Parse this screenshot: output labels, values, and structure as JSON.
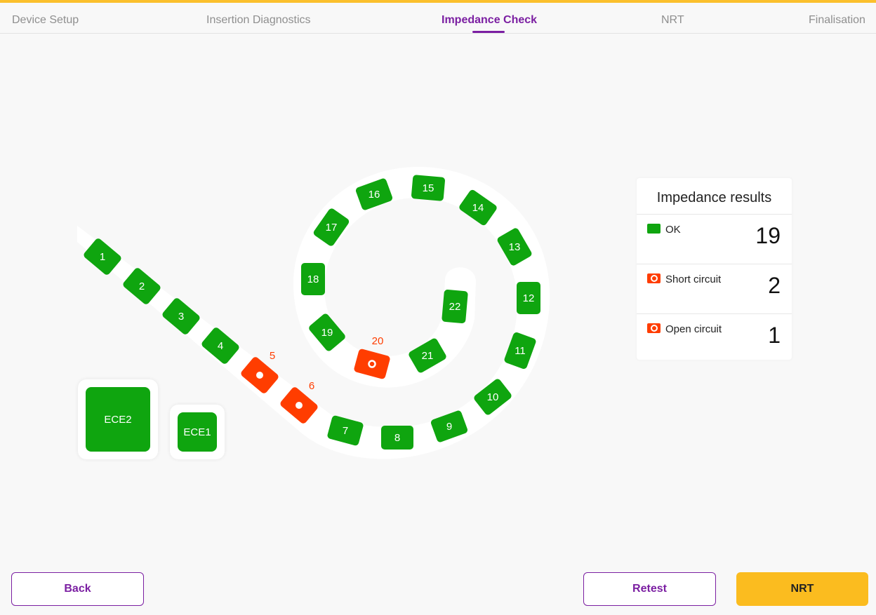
{
  "tabs": [
    {
      "label": "Device Setup",
      "active": false
    },
    {
      "label": "Insertion Diagnostics",
      "active": false
    },
    {
      "label": "Impedance Check",
      "active": true
    },
    {
      "label": "NRT",
      "active": false
    },
    {
      "label": "Finalisation",
      "active": false
    }
  ],
  "electrodes": [
    {
      "label": "1",
      "status": "ok"
    },
    {
      "label": "2",
      "status": "ok"
    },
    {
      "label": "3",
      "status": "ok"
    },
    {
      "label": "4",
      "status": "ok"
    },
    {
      "label": "5",
      "status": "short"
    },
    {
      "label": "6",
      "status": "short"
    },
    {
      "label": "7",
      "status": "ok"
    },
    {
      "label": "8",
      "status": "ok"
    },
    {
      "label": "9",
      "status": "ok"
    },
    {
      "label": "10",
      "status": "ok"
    },
    {
      "label": "11",
      "status": "ok"
    },
    {
      "label": "12",
      "status": "ok"
    },
    {
      "label": "13",
      "status": "ok"
    },
    {
      "label": "14",
      "status": "ok"
    },
    {
      "label": "15",
      "status": "ok"
    },
    {
      "label": "16",
      "status": "ok"
    },
    {
      "label": "17",
      "status": "ok"
    },
    {
      "label": "18",
      "status": "ok"
    },
    {
      "label": "19",
      "status": "ok"
    },
    {
      "label": "20",
      "status": "open"
    },
    {
      "label": "21",
      "status": "ok"
    },
    {
      "label": "22",
      "status": "ok"
    }
  ],
  "ece": [
    {
      "label": "ECE2",
      "status": "ok"
    },
    {
      "label": "ECE1",
      "status": "ok"
    }
  ],
  "results": {
    "title": "Impedance results",
    "rows": [
      {
        "label": "OK",
        "count": "19",
        "icon": "ok-swatch-icon"
      },
      {
        "label": "Short circuit",
        "count": "2",
        "icon": "short-circuit-icon"
      },
      {
        "label": "Open circuit",
        "count": "1",
        "icon": "open-circuit-icon"
      }
    ]
  },
  "buttons": {
    "back": "Back",
    "retest": "Retest",
    "next": "NRT"
  },
  "colors": {
    "accent": "#7b1fa2",
    "ok": "#0fa50f",
    "fault": "#ff3d00",
    "primary": "#fbbc1f",
    "top_bar": "#fbc02d"
  }
}
